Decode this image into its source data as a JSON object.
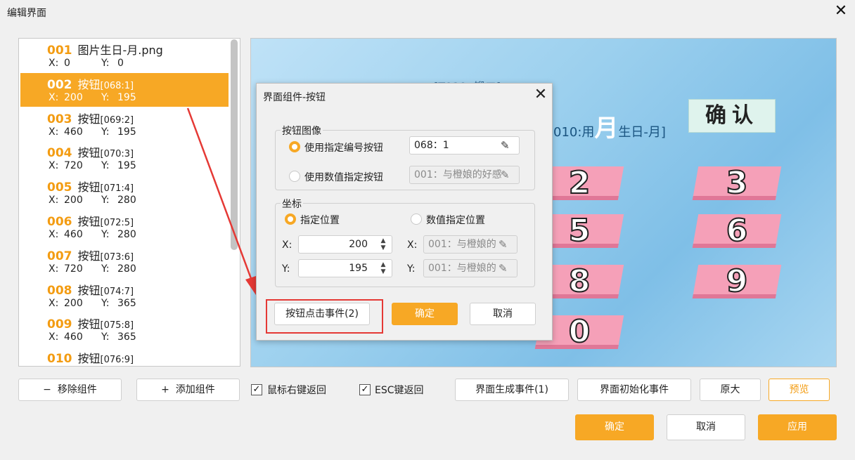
{
  "window": {
    "title": "编辑界面",
    "close": "✕"
  },
  "components": [
    {
      "num": "001",
      "name": "图片生日-月.png",
      "bracket": "",
      "x_label": "X:",
      "x": "0",
      "y_label": "Y:",
      "y": "0"
    },
    {
      "num": "002",
      "name": "按钮",
      "bracket": "[068:1]",
      "x_label": "X:",
      "x": "200",
      "y_label": "Y:",
      "y": "195"
    },
    {
      "num": "003",
      "name": "按钮",
      "bracket": "[069:2]",
      "x_label": "X:",
      "x": "460",
      "y_label": "Y:",
      "y": "195"
    },
    {
      "num": "004",
      "name": "按钮",
      "bracket": "[070:3]",
      "x_label": "X:",
      "x": "720",
      "y_label": "Y:",
      "y": "195"
    },
    {
      "num": "005",
      "name": "按钮",
      "bracket": "[071:4]",
      "x_label": "X:",
      "x": "200",
      "y_label": "Y:",
      "y": "280"
    },
    {
      "num": "006",
      "name": "按钮",
      "bracket": "[072:5]",
      "x_label": "X:",
      "x": "460",
      "y_label": "Y:",
      "y": "280"
    },
    {
      "num": "007",
      "name": "按钮",
      "bracket": "[073:6]",
      "x_label": "X:",
      "x": "720",
      "y_label": "Y:",
      "y": "280"
    },
    {
      "num": "008",
      "name": "按钮",
      "bracket": "[074:7]",
      "x_label": "X:",
      "x": "200",
      "y_label": "Y:",
      "y": "365"
    },
    {
      "num": "009",
      "name": "按钮",
      "bracket": "[075:8]",
      "x_label": "X:",
      "x": "460",
      "y_label": "Y:",
      "y": "365"
    },
    {
      "num": "010",
      "name": "按钮",
      "bracket": "[076:9]",
      "x_label": "",
      "x": "",
      "y_label": "",
      "y": ""
    }
  ],
  "preview": {
    "title": "[T010: 锻二]",
    "subtitle_prefix": "010:用",
    "subtitle_big": "月",
    "subtitle_suffix": "生日-月]",
    "confirm": "确认",
    "tiles": [
      "2",
      "3",
      "5",
      "6",
      "8",
      "9",
      "0"
    ]
  },
  "dialog": {
    "title": "界面组件-按钮",
    "close": "✕",
    "image_group": {
      "label": "按钮图像",
      "opt1": "使用指定编号按钮",
      "opt1_value": "068：1",
      "opt2": "使用数值指定按钮",
      "opt2_value": "001：与橙娘的好感"
    },
    "coord_group": {
      "label": "坐标",
      "opt1": "指定位置",
      "opt2": "数值指定位置",
      "x_label": "X:",
      "y_label": "Y:",
      "x_value": "200",
      "y_value": "195",
      "x_var": "001：与橙娘的",
      "y_var": "001：与橙娘的"
    },
    "event_button": "按钮点击事件(2)",
    "ok": "确定",
    "cancel": "取消"
  },
  "bottom": {
    "remove": "移除组件",
    "add": "添加组件",
    "right_click_back": "鼠标右键返回",
    "esc_back": "ESC键返回",
    "gen_event": "界面生成事件(1)",
    "init_event": "界面初始化事件",
    "original_size": "原大",
    "preview": "预览",
    "ok": "确定",
    "cancel": "取消",
    "apply": "应用"
  },
  "colors": {
    "accent": "#f7a825",
    "highlight": "#e53935"
  }
}
